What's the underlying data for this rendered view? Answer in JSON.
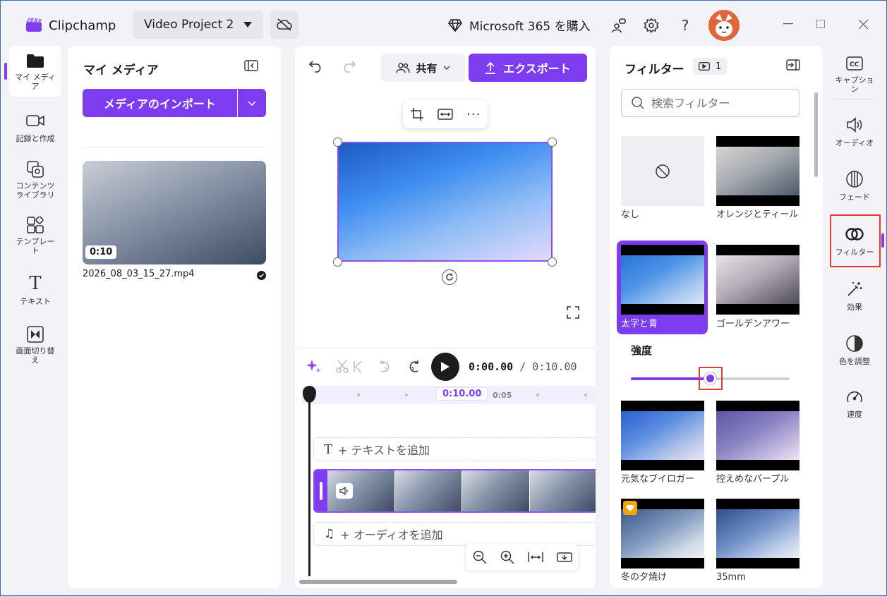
{
  "titlebar": {
    "app_name": "Clipchamp",
    "project_name": "Video Project 2",
    "ms365_label": "Microsoft 365 を購入"
  },
  "left_rail": {
    "items": [
      {
        "label": "マイ メディア",
        "icon": "folder-icon",
        "active": true
      },
      {
        "label": "記録と作成",
        "icon": "camera-icon"
      },
      {
        "label": "コンテンツ ライブラリ",
        "icon": "library-icon"
      },
      {
        "label": "テンプレート",
        "icon": "templates-icon"
      },
      {
        "label": "テキスト",
        "icon": "text-icon"
      },
      {
        "label": "画面切り替え",
        "icon": "transitions-icon"
      }
    ]
  },
  "media": {
    "title": "マイ メディア",
    "import_label": "メディアのインポート",
    "file_name": "2026_08_03_15_27.mp4",
    "duration": "0:10"
  },
  "preview": {
    "share_label": "共有",
    "export_label": "エクスポート",
    "time_current": "0:00.00",
    "time_total": "/ 0:10.00",
    "ruler_marker": "0:10.00",
    "ruler_tick": "0:05",
    "add_text": "+ テキストを追加",
    "add_audio": "+ オーディオを追加"
  },
  "filters": {
    "title": "フィルター",
    "applied_count": "1",
    "search_placeholder": "検索フィルター",
    "intensity_label": "強度",
    "intensity_value": 0.5,
    "items": [
      {
        "label": "なし"
      },
      {
        "label": "オレンジとティール"
      },
      {
        "label": "太字と青",
        "selected": true
      },
      {
        "label": "ゴールデンアワー"
      },
      {
        "label": "元気なブイロガー"
      },
      {
        "label": "控えめなパープル"
      },
      {
        "label": "冬の夕焼け",
        "premium": true
      },
      {
        "label": "35mm"
      }
    ]
  },
  "right_rail": {
    "items": [
      {
        "label": "キャプション",
        "icon": "captions-icon"
      },
      {
        "label": "オーディオ",
        "icon": "audio-icon"
      },
      {
        "label": "フェード",
        "icon": "fade-icon"
      },
      {
        "label": "フィルター",
        "icon": "filters-icon",
        "active": true
      },
      {
        "label": "効果",
        "icon": "effects-icon"
      },
      {
        "label": "色を調整",
        "icon": "color-adjust-icon"
      },
      {
        "label": "速度",
        "icon": "speed-icon"
      }
    ]
  },
  "colors": {
    "accent": "#7d3cf0",
    "highlight": "#e53935"
  }
}
